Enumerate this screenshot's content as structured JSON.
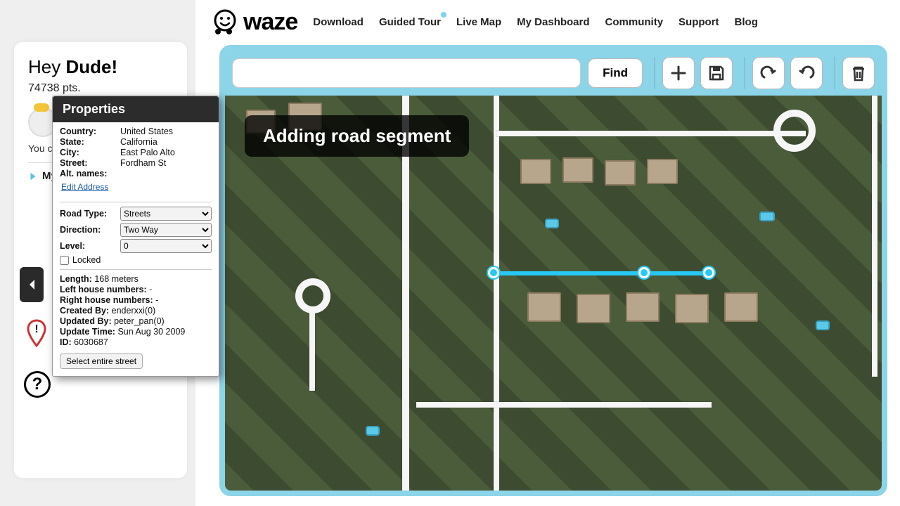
{
  "sidebar": {
    "greeting_prefix": "Hey ",
    "greeting_name": "Dude!",
    "points": "74738 pts.",
    "hint": "You ca\nroads y",
    "my_places": "My Pl"
  },
  "nav": {
    "brand": "waze",
    "items": [
      "Download",
      "Guided Tour",
      "Live Map",
      "My Dashboard",
      "Community",
      "Support",
      "Blog"
    ]
  },
  "toolbar": {
    "search_placeholder": "",
    "find_label": "Find"
  },
  "overlay": {
    "title": "Adding road segment"
  },
  "properties": {
    "title": "Properties",
    "address": {
      "country_label": "Country:",
      "country": "United States",
      "state_label": "State:",
      "state": "California",
      "city_label": "City:",
      "city": "East Palo Alto",
      "street_label": "Street:",
      "street": "Fordham St",
      "alt_label": "Alt. names:",
      "alt": "",
      "edit_link": "Edit Address"
    },
    "road": {
      "road_type_label": "Road Type:",
      "road_type": "Streets",
      "direction_label": "Direction:",
      "direction": "Two Way",
      "level_label": "Level:",
      "level": "0",
      "locked_label": "Locked"
    },
    "meta": {
      "length_label": "Length:",
      "length": "168 meters",
      "left_label": "Left house numbers:",
      "left": "-",
      "right_label": "Right house numbers:",
      "right": "-",
      "created_by_label": "Created By:",
      "created_by": "enderxxi(0)",
      "updated_by_label": "Updated By:",
      "updated_by": "peter_pan(0)",
      "update_time_label": "Update Time:",
      "update_time": "Sun Aug 30 2009",
      "id_label": "ID:",
      "id": "6030687",
      "select_street": "Select entire street"
    }
  }
}
